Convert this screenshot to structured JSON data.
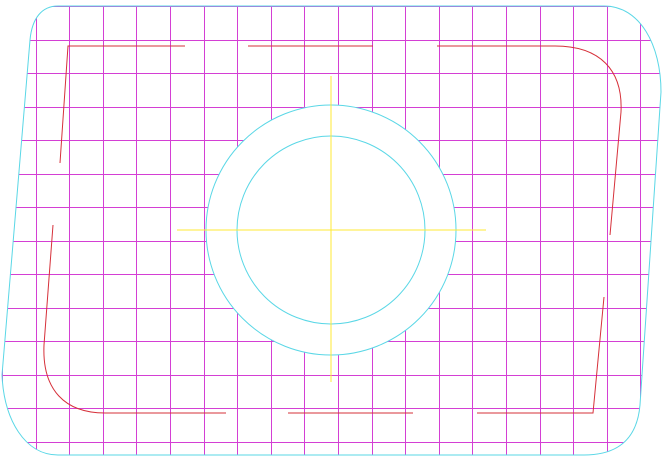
{
  "drawing": {
    "colors": {
      "background": "#ffffff",
      "outline": "#5ad7e6",
      "grid": "#d43fd4",
      "toolpath": "#d6303a",
      "centerline": "#ffea33"
    },
    "grid_cells": {
      "columns": 19,
      "rows": 14
    },
    "grid_clipped_to_outline": true,
    "toolpath_segments": 12,
    "central_circles": 2,
    "center_crosshair": true
  }
}
